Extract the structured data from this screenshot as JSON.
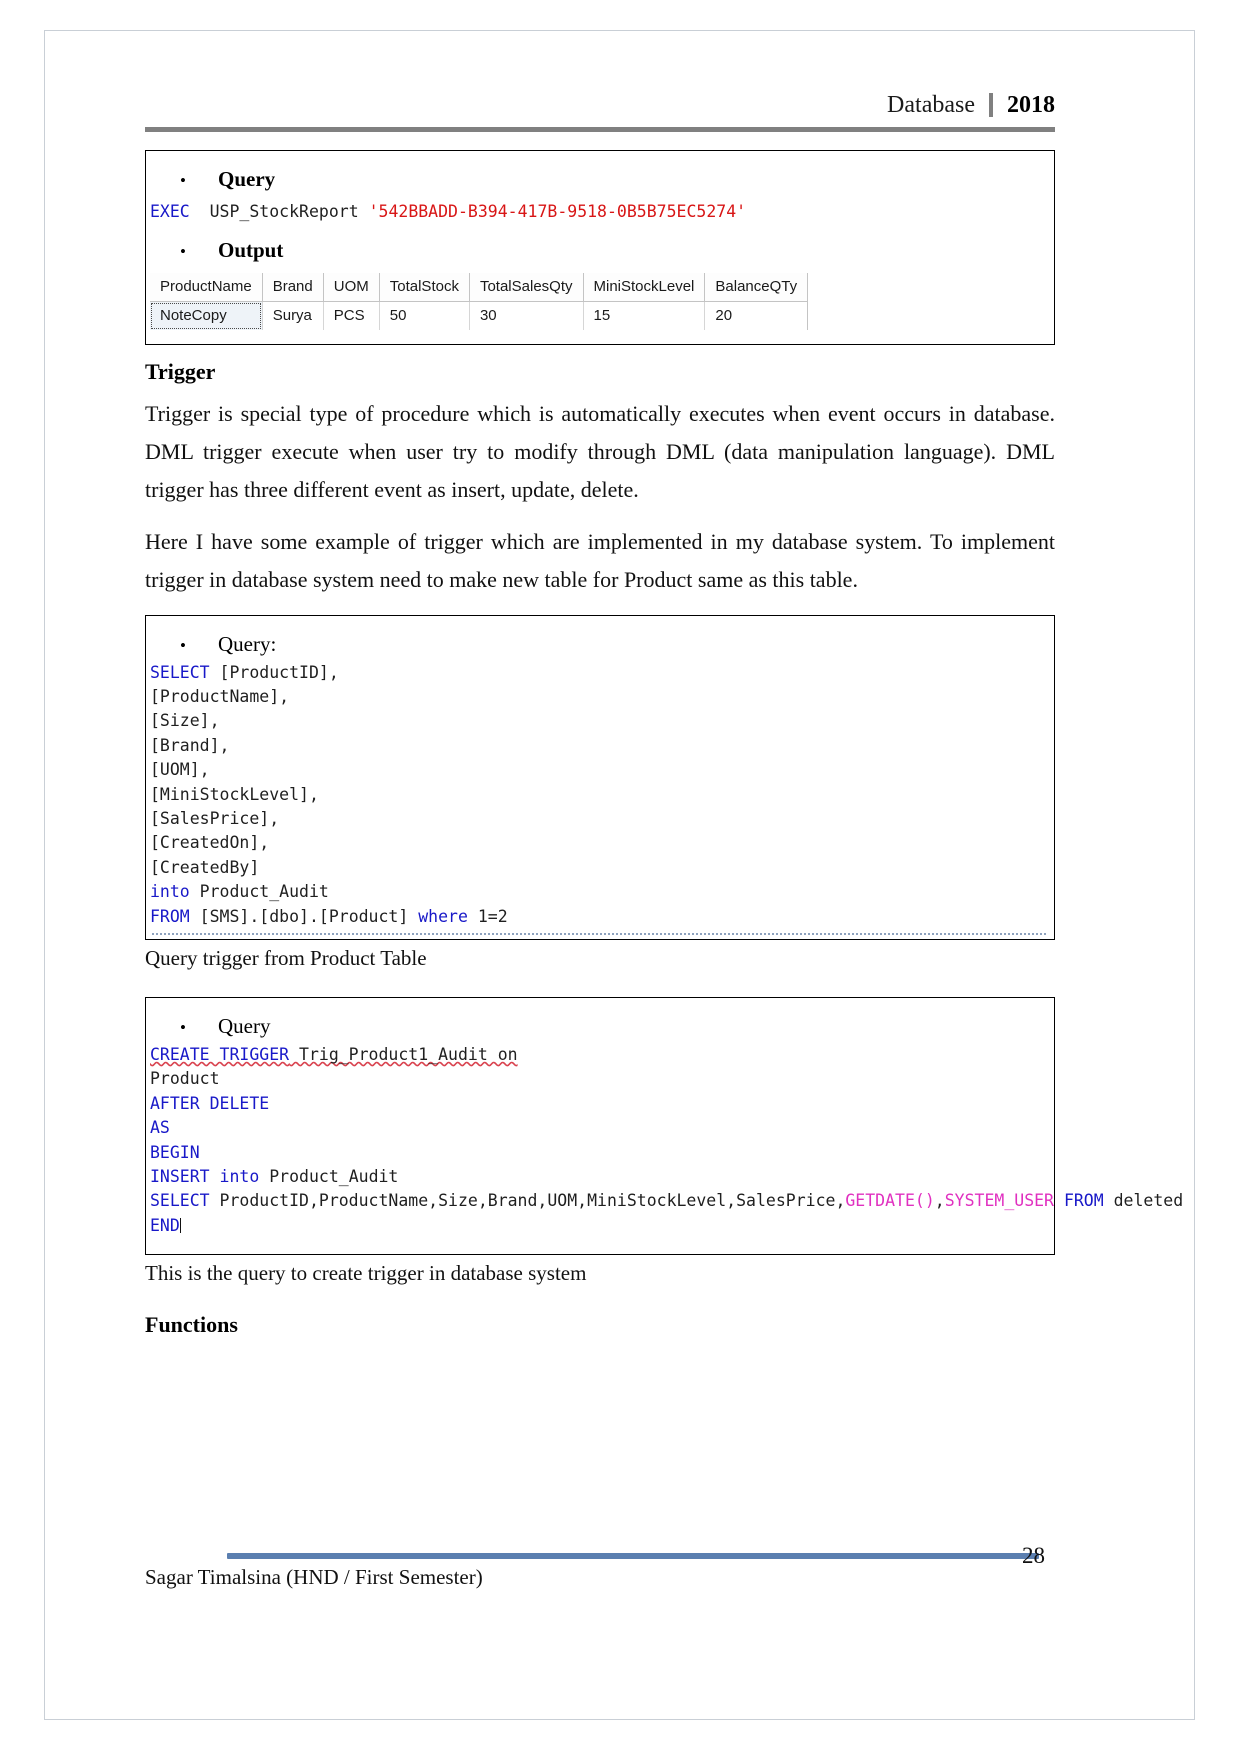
{
  "header": {
    "label": "Database",
    "year": "2018"
  },
  "block1": {
    "bullet": "Query",
    "bullet_glyph": "•",
    "code": {
      "keyword": "EXEC",
      "proc": "USP_StockReport",
      "param": "'542BBADD-B394-417B-9518-0B5B75EC5274'"
    },
    "output_bullet": "Output",
    "table": {
      "columns": [
        "ProductName",
        "Brand",
        "UOM",
        "TotalStock",
        "TotalSalesQty",
        "MiniStockLevel",
        "BalanceQTy"
      ],
      "rows": [
        [
          "NoteCopy",
          "Surya",
          "PCS",
          "50",
          "30",
          "15",
          "20"
        ]
      ]
    }
  },
  "trigger_section": {
    "title": "Trigger",
    "paragraph1": "Trigger is special type of procedure which is automatically executes when event occurs in database. DML trigger execute when user try to modify through DML (data manipulation language). DML trigger has three different event as insert, update, delete.",
    "paragraph2": "Here I have some example of trigger which are implemented in my database system. To implement trigger in database system need to make new table for Product same as this table."
  },
  "block2": {
    "bullet": "Query:",
    "bullet_glyph": "•",
    "lines": [
      {
        "parts": [
          {
            "t": "SELECT",
            "c": "kw"
          },
          {
            "t": " [ProductID],",
            "c": "plain"
          }
        ]
      },
      {
        "parts": [
          {
            "t": "[ProductName],",
            "c": "plain"
          }
        ]
      },
      {
        "parts": [
          {
            "t": "[Size],",
            "c": "plain"
          }
        ]
      },
      {
        "parts": [
          {
            "t": "[Brand],",
            "c": "plain"
          }
        ]
      },
      {
        "parts": [
          {
            "t": "[UOM],",
            "c": "plain"
          }
        ]
      },
      {
        "parts": [
          {
            "t": "[MiniStockLevel],",
            "c": "plain"
          }
        ]
      },
      {
        "parts": [
          {
            "t": "[SalesPrice],",
            "c": "plain"
          }
        ]
      },
      {
        "parts": [
          {
            "t": "[CreatedOn],",
            "c": "plain"
          }
        ]
      },
      {
        "parts": [
          {
            "t": "[CreatedBy]",
            "c": "plain"
          }
        ]
      },
      {
        "parts": [
          {
            "t": "into",
            "c": "kw"
          },
          {
            "t": " Product_Audit",
            "c": "plain"
          }
        ]
      },
      {
        "parts": [
          {
            "t": "FROM",
            "c": "kw"
          },
          {
            "t": " [SMS].[dbo].[Product] ",
            "c": "plain"
          },
          {
            "t": "where",
            "c": "kw"
          },
          {
            "t": " 1=2",
            "c": "plain"
          }
        ]
      }
    ],
    "caption": "Query trigger from Product Table"
  },
  "block3": {
    "bullet": "Query",
    "bullet_glyph": "•",
    "lines": [
      {
        "parts": [
          {
            "t": "CREATE TRIGGER",
            "c": "kw squiggle"
          },
          {
            "t": " Trig_Product1_Audit on",
            "c": "plain squiggle"
          }
        ]
      },
      {
        "parts": [
          {
            "t": "Product",
            "c": "plain"
          }
        ]
      },
      {
        "parts": [
          {
            "t": "AFTER DELETE",
            "c": "kw"
          }
        ]
      },
      {
        "parts": [
          {
            "t": "AS",
            "c": "kw"
          }
        ]
      },
      {
        "parts": [
          {
            "t": "BEGIN",
            "c": "kw"
          }
        ]
      },
      {
        "parts": [
          {
            "t": "INSERT",
            "c": "kw"
          },
          {
            "t": " ",
            "c": "plain"
          },
          {
            "t": "into",
            "c": "kw"
          },
          {
            "t": " Product_Audit",
            "c": "plain"
          }
        ]
      },
      {
        "parts": [
          {
            "t": "SELECT",
            "c": "kw"
          },
          {
            "t": " ProductID,ProductName,Size,Brand,UOM,MiniStockLevel,SalesPrice,",
            "c": "plain"
          },
          {
            "t": "GETDATE()",
            "c": "fn"
          },
          {
            "t": ",",
            "c": "plain"
          },
          {
            "t": "SYSTEM_USER",
            "c": "fn"
          },
          {
            "t": " ",
            "c": "plain"
          },
          {
            "t": "FROM",
            "c": "kw"
          },
          {
            "t": " deleted",
            "c": "plain"
          }
        ]
      },
      {
        "parts": [
          {
            "t": "END",
            "c": "kw"
          }
        ],
        "caret": true
      }
    ],
    "caption": "This is the query to create trigger in database system"
  },
  "functions_section": {
    "title": "Functions"
  },
  "footer": {
    "author": "Sagar Timalsina (HND / First Semester)",
    "page_number": "28"
  }
}
